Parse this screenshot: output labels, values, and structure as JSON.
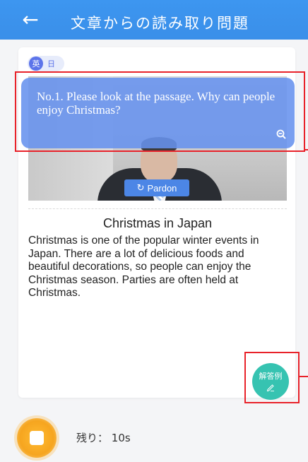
{
  "header": {
    "title": "文章からの読み取り問題",
    "back_icon": "←"
  },
  "language": {
    "english": "英",
    "japanese": "日"
  },
  "question": {
    "text": "No.1. Please look at the passage. Why can people enjoy Christmas?"
  },
  "video": {
    "pardon_icon": "↻",
    "pardon_label": "Pardon"
  },
  "passage": {
    "title": "Christmas in Japan",
    "body": "Christmas is one of the popular winter events in Japan. There are a lot of delicious foods and beautiful decorations, so people can enjoy the Christmas season. Parties are often held at Christmas."
  },
  "answer_example": {
    "label": "解答例"
  },
  "footer": {
    "timer_label": "残り：",
    "timer_value": "10s"
  },
  "colors": {
    "header": "#3a8fe9",
    "bubble": "#6792ee",
    "answer_button": "#36c3b1",
    "record_button": "#f6a51f",
    "highlight": "#e8222a"
  }
}
